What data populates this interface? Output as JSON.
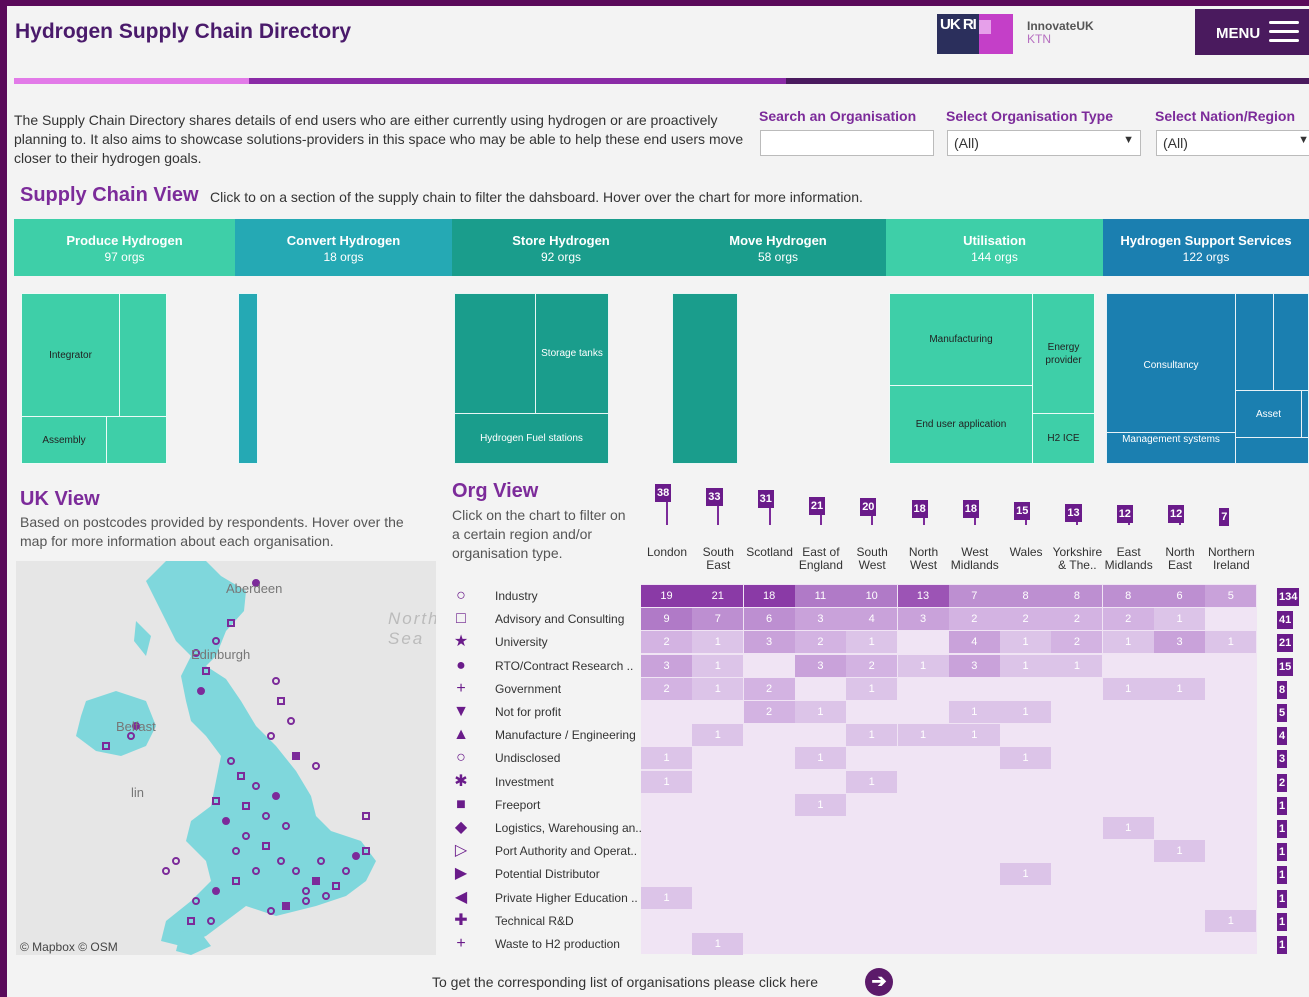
{
  "header": {
    "title": "Hydrogen Supply Chain Directory",
    "logo_text": "UK RI",
    "brand": "InnovateUK",
    "brand_sub": "KTN",
    "menu_label": "MENU"
  },
  "intro": "The Supply Chain Directory shares details of end users who are either currently using hydrogen or are proactively planning to. It also aims to showcase solutions-providers in this space who may be able to help these end users move closer to their hydrogen goals.",
  "filters": {
    "search_label": "Search an Organisation",
    "search_value": "",
    "type_label": "Select Organisation Type",
    "type_value": "(All)",
    "region_label": "Select Nation/Region",
    "region_value": "(All)"
  },
  "supply_chain": {
    "title": "Supply Chain View",
    "description": "Click to on a section of the supply chain to filter the dahsboard. Hover over the chart for more information.",
    "categories": [
      {
        "name": "Produce Hydrogen",
        "count": "97 orgs"
      },
      {
        "name": "Convert Hydrogen",
        "count": "18 orgs"
      },
      {
        "name": "Store Hydrogen",
        "count": "92 orgs"
      },
      {
        "name": "Move Hydrogen",
        "count": "58 orgs"
      },
      {
        "name": "Utilisation",
        "count": "144 orgs"
      },
      {
        "name": "Hydrogen Support Services",
        "count": "122 orgs"
      }
    ],
    "treemap_labels": {
      "integrator": "Integrator",
      "assembly": "Assembly",
      "storage_tanks": "Storage tanks",
      "fuel_stations": "Hydrogen Fuel stations",
      "manufacturing": "Manufacturing",
      "energy_provider": "Energy provider",
      "end_user": "End user application",
      "h2_ice": "H2 ICE",
      "consultancy": "Consultancy",
      "asset": "Asset",
      "management": "Management systems"
    },
    "colors": {
      "green": "#3ecfa8",
      "teal": "#25a9b4",
      "dark_teal": "#1a9d8c",
      "blue": "#1b7fb0"
    }
  },
  "uk_view": {
    "title": "UK View",
    "description": "Based on postcodes provided by respondents. Hover over the map for more information about each organisation.",
    "map_labels": {
      "north_sea_1": "North",
      "north_sea_2": "Sea",
      "aberdeen": "Aberdeen",
      "edinburgh": "Edinburgh",
      "belfast": "Belfast",
      "dublin": "lin"
    },
    "attribution": "© Mapbox  © OSM"
  },
  "org_view": {
    "title": "Org View",
    "description": "Click on the chart to filter on a certain region and/or organisation type.",
    "regions": [
      {
        "name": "London",
        "total": 38
      },
      {
        "name": "South East",
        "total": 33
      },
      {
        "name": "Scotland",
        "total": 31
      },
      {
        "name": "East of England",
        "total": 21
      },
      {
        "name": "South West",
        "total": 20
      },
      {
        "name": "North West",
        "total": 18
      },
      {
        "name": "West Midlands",
        "total": 18
      },
      {
        "name": "Wales",
        "total": 15
      },
      {
        "name": "Yorkshire & The..",
        "total": 13
      },
      {
        "name": "East Midlands",
        "total": 12
      },
      {
        "name": "North East",
        "total": 12
      },
      {
        "name": "Northern Ireland",
        "total": 7
      }
    ],
    "rows": [
      {
        "label": "Industry",
        "shape": "○",
        "total": "134",
        "values": [
          19,
          21,
          18,
          11,
          10,
          13,
          7,
          8,
          8,
          8,
          6,
          5
        ]
      },
      {
        "label": "Advisory and Consulting",
        "shape": "□",
        "total": "41",
        "values": [
          9,
          7,
          6,
          3,
          4,
          3,
          2,
          2,
          2,
          2,
          1,
          null
        ]
      },
      {
        "label": "University",
        "shape": "★",
        "total": "21",
        "values": [
          2,
          1,
          3,
          2,
          1,
          null,
          4,
          1,
          2,
          1,
          3,
          1
        ]
      },
      {
        "label": "RTO/Contract Research ..",
        "shape": "●",
        "total": "15",
        "values": [
          3,
          1,
          null,
          3,
          2,
          1,
          3,
          1,
          1,
          null,
          null,
          null
        ]
      },
      {
        "label": "Government",
        "shape": "+",
        "total": "8",
        "values": [
          2,
          1,
          2,
          null,
          1,
          null,
          null,
          null,
          null,
          1,
          1,
          null
        ]
      },
      {
        "label": "Not for profit",
        "shape": "▼",
        "total": "5",
        "values": [
          null,
          null,
          2,
          1,
          null,
          null,
          1,
          1,
          null,
          null,
          null,
          null
        ]
      },
      {
        "label": "Manufacture / Engineering",
        "shape": "▲",
        "total": "4",
        "values": [
          null,
          1,
          null,
          null,
          1,
          1,
          1,
          null,
          null,
          null,
          null,
          null
        ]
      },
      {
        "label": "Undisclosed",
        "shape": "○",
        "total": "3",
        "values": [
          1,
          null,
          null,
          1,
          null,
          null,
          null,
          1,
          null,
          null,
          null,
          null
        ]
      },
      {
        "label": "Investment",
        "shape": "✱",
        "total": "2",
        "values": [
          1,
          null,
          null,
          null,
          1,
          null,
          null,
          null,
          null,
          null,
          null,
          null
        ]
      },
      {
        "label": "Freeport",
        "shape": "■",
        "total": "1",
        "values": [
          null,
          null,
          null,
          1,
          null,
          null,
          null,
          null,
          null,
          null,
          null,
          null
        ]
      },
      {
        "label": "Logistics, Warehousing an..",
        "shape": "◆",
        "total": "1",
        "values": [
          null,
          null,
          null,
          null,
          null,
          null,
          null,
          null,
          null,
          1,
          null,
          null
        ]
      },
      {
        "label": "Port Authority and Operat..",
        "shape": "▷",
        "total": "1",
        "values": [
          null,
          null,
          null,
          null,
          null,
          null,
          null,
          null,
          null,
          null,
          1,
          null
        ]
      },
      {
        "label": "Potential Distributor",
        "shape": "▶",
        "total": "1",
        "values": [
          null,
          null,
          null,
          null,
          null,
          null,
          null,
          1,
          null,
          null,
          null,
          null
        ]
      },
      {
        "label": "Private Higher Education ..",
        "shape": "◀",
        "total": "1",
        "values": [
          1,
          null,
          null,
          null,
          null,
          null,
          null,
          null,
          null,
          null,
          null,
          null
        ]
      },
      {
        "label": "Technical R&D",
        "shape": "✚",
        "total": "1",
        "values": [
          null,
          null,
          null,
          null,
          null,
          null,
          null,
          null,
          null,
          null,
          null,
          1
        ]
      },
      {
        "label": "Waste to H2 production",
        "shape": "+",
        "total": "1",
        "values": [
          null,
          1,
          null,
          null,
          null,
          null,
          null,
          null,
          null,
          null,
          null,
          null
        ]
      }
    ]
  },
  "footer": {
    "text": "To get the corresponding list of organisations please click here",
    "button_icon": "arrow-right-icon"
  }
}
